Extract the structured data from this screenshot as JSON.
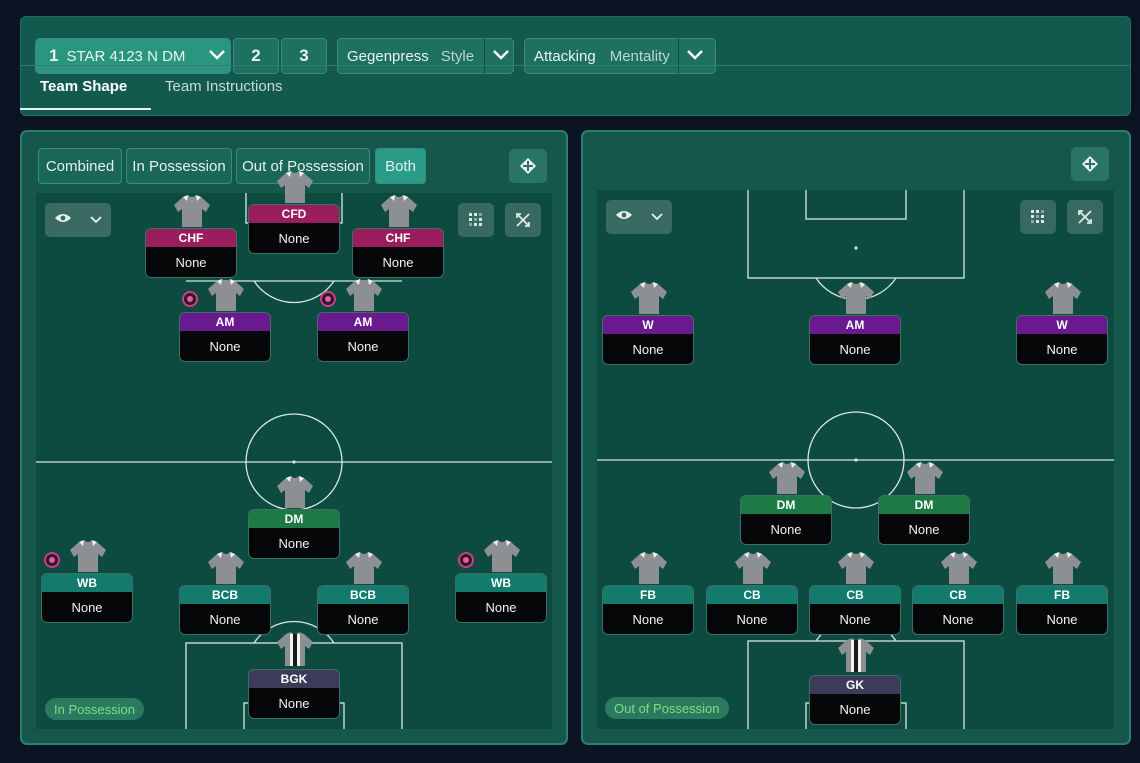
{
  "tactic_bar": {
    "slot_active": "1",
    "tactic_name": "STAR 4123 N DM",
    "slot_2": "2",
    "slot_3": "3",
    "style_value": "Gegenpress",
    "style_label": "Style",
    "mentality_value": "Attacking",
    "mentality_label": "Mentality"
  },
  "tabs": {
    "team_shape": "Team Shape",
    "team_instructions": "Team Instructions"
  },
  "view_modes": {
    "combined": "Combined",
    "in_possession": "In Possession",
    "out_of_possession": "Out of Possession",
    "both": "Both",
    "active": "Both"
  },
  "left_panel": {
    "badge": "In Possession",
    "players": [
      {
        "role": "CFD",
        "name": "None",
        "color": "#9a1e5e"
      },
      {
        "role": "CHF",
        "name": "None",
        "color": "#9a1e5e"
      },
      {
        "role": "CHF",
        "name": "None",
        "color": "#9a1e5e"
      },
      {
        "role": "AM",
        "name": "None",
        "color": "#6a1a8e"
      },
      {
        "role": "AM",
        "name": "None",
        "color": "#6a1a8e"
      },
      {
        "role": "DM",
        "name": "None",
        "color": "#1d7a45"
      },
      {
        "role": "WB",
        "name": "None",
        "color": "#137a6e"
      },
      {
        "role": "BCB",
        "name": "None",
        "color": "#137a6e"
      },
      {
        "role": "BCB",
        "name": "None",
        "color": "#137a6e"
      },
      {
        "role": "WB",
        "name": "None",
        "color": "#137a6e"
      },
      {
        "role": "BGK",
        "name": "None",
        "color": "#3d3b5a"
      }
    ]
  },
  "right_panel": {
    "badge": "Out of Possession",
    "players": [
      {
        "role": "W",
        "name": "None",
        "color": "#6a1a8e"
      },
      {
        "role": "AM",
        "name": "None",
        "color": "#6a1a8e"
      },
      {
        "role": "W",
        "name": "None",
        "color": "#6a1a8e"
      },
      {
        "role": "DM",
        "name": "None",
        "color": "#1d7a45"
      },
      {
        "role": "DM",
        "name": "None",
        "color": "#1d7a45"
      },
      {
        "role": "FB",
        "name": "None",
        "color": "#137a6e"
      },
      {
        "role": "CB",
        "name": "None",
        "color": "#137a6e"
      },
      {
        "role": "CB",
        "name": "None",
        "color": "#137a6e"
      },
      {
        "role": "CB",
        "name": "None",
        "color": "#137a6e"
      },
      {
        "role": "FB",
        "name": "None",
        "color": "#137a6e"
      },
      {
        "role": "GK",
        "name": "None",
        "color": "#3d3b5a"
      }
    ]
  },
  "icons": {
    "expand": "arrows-expand-icon",
    "view": "eye-icon",
    "grid": "grid-icon",
    "tactics_board": "tactics-board-icon"
  }
}
